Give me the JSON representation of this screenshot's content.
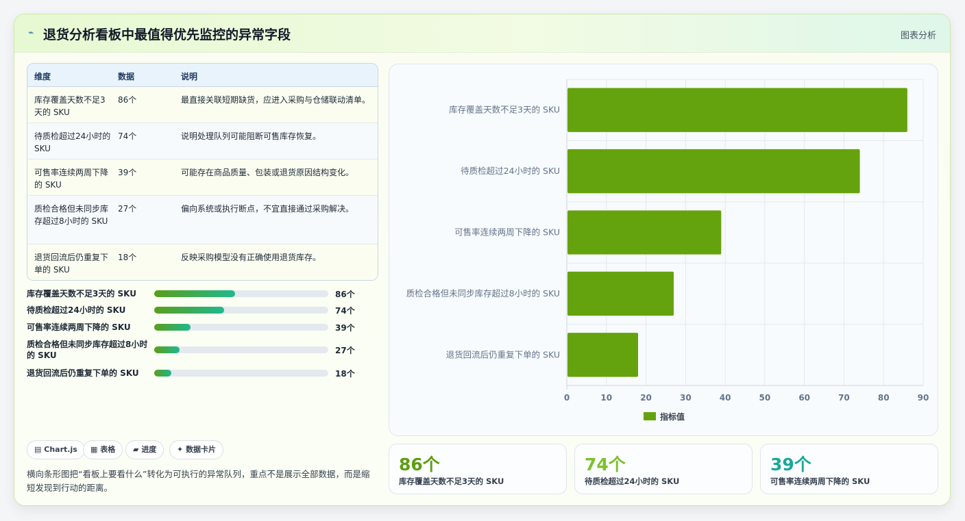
{
  "header": {
    "icon": "chart-line-icon",
    "title": "退货分析看板中最值得优先监控的异常字段",
    "tag": "图表分析"
  },
  "table": {
    "headers": [
      "维度",
      "数据",
      "说明"
    ],
    "rows": [
      {
        "dim": "库存覆盖天数不足3天的 SKU",
        "value": "86个",
        "desc": "最直接关联短期缺货，应进入采购与仓储联动清单。"
      },
      {
        "dim": "待质检超过24小时的 SKU",
        "value": "74个",
        "desc": "说明处理队列可能阻断可售库存恢复。"
      },
      {
        "dim": "可售率连续两周下降的 SKU",
        "value": "39个",
        "desc": "可能存在商品质量、包装或退货原因结构变化。"
      },
      {
        "dim": "质检合格但未同步库存超过8小时的 SKU",
        "value": "27个",
        "desc": "偏向系统或执行断点，不宜直接通过采购解决。"
      },
      {
        "dim": "退货回流后仍重复下单的 SKU",
        "value": "18个",
        "desc": "反映采购模型没有正确使用退货库存。"
      }
    ]
  },
  "progress": [
    {
      "label": "库存覆盖天数不足3天的 SKU",
      "value": "86个",
      "fraction": 0.464
    },
    {
      "label": "待质检超过24小时的 SKU",
      "value": "74个",
      "fraction": 0.4
    },
    {
      "label": "可售率连续两周下降的 SKU",
      "value": "39个",
      "fraction": 0.21
    },
    {
      "label": "质检合格但未同步库存超过8小时的 SKU",
      "value": "27个",
      "fraction": 0.146
    },
    {
      "label": "退货回流后仍重复下单的 SKU",
      "value": "18个",
      "fraction": 0.097
    }
  ],
  "pills": [
    {
      "icon": "chart-icon",
      "glyph": "▤",
      "label": "Chart.js"
    },
    {
      "icon": "table-icon",
      "glyph": "▦",
      "label": "表格"
    },
    {
      "icon": "progress-icon",
      "glyph": "▰",
      "label": "进度"
    },
    {
      "icon": "sparkle-icon",
      "glyph": "✦",
      "label": "数据卡片"
    }
  ],
  "note": "横向条形图把“看板上要看什么”转化为可执行的异常队列，重点不是展示全部数据，而是缩短发现到行动的距离。",
  "stats": [
    {
      "value": "86个",
      "label": "库存覆盖天数不足3天的 SKU",
      "color": "#5e9e0f"
    },
    {
      "value": "74个",
      "label": "待质检超过24小时的 SKU",
      "color": "#7cc12b"
    },
    {
      "value": "39个",
      "label": "可售率连续两周下降的 SKU",
      "color": "#1aa89a"
    }
  ],
  "chart_data": {
    "type": "bar",
    "orientation": "horizontal",
    "categories": [
      "库存覆盖天数不足3天的 SKU",
      "待质检超过24小时的 SKU",
      "可售率连续两周下降的 SKU",
      "质检合格但未同步库存超过8小时的 SKU",
      "退货回流后仍重复下单的 SKU"
    ],
    "series": [
      {
        "name": "指标值",
        "values": [
          86,
          74,
          39,
          27,
          18
        ],
        "color": "#64a30d"
      }
    ],
    "xlim": [
      0,
      90
    ],
    "xticks": [
      0,
      10,
      20,
      30,
      40,
      50,
      60,
      70,
      80,
      90
    ],
    "grid": true,
    "legend": "bottom",
    "title": "",
    "xlabel": "",
    "ylabel": ""
  }
}
